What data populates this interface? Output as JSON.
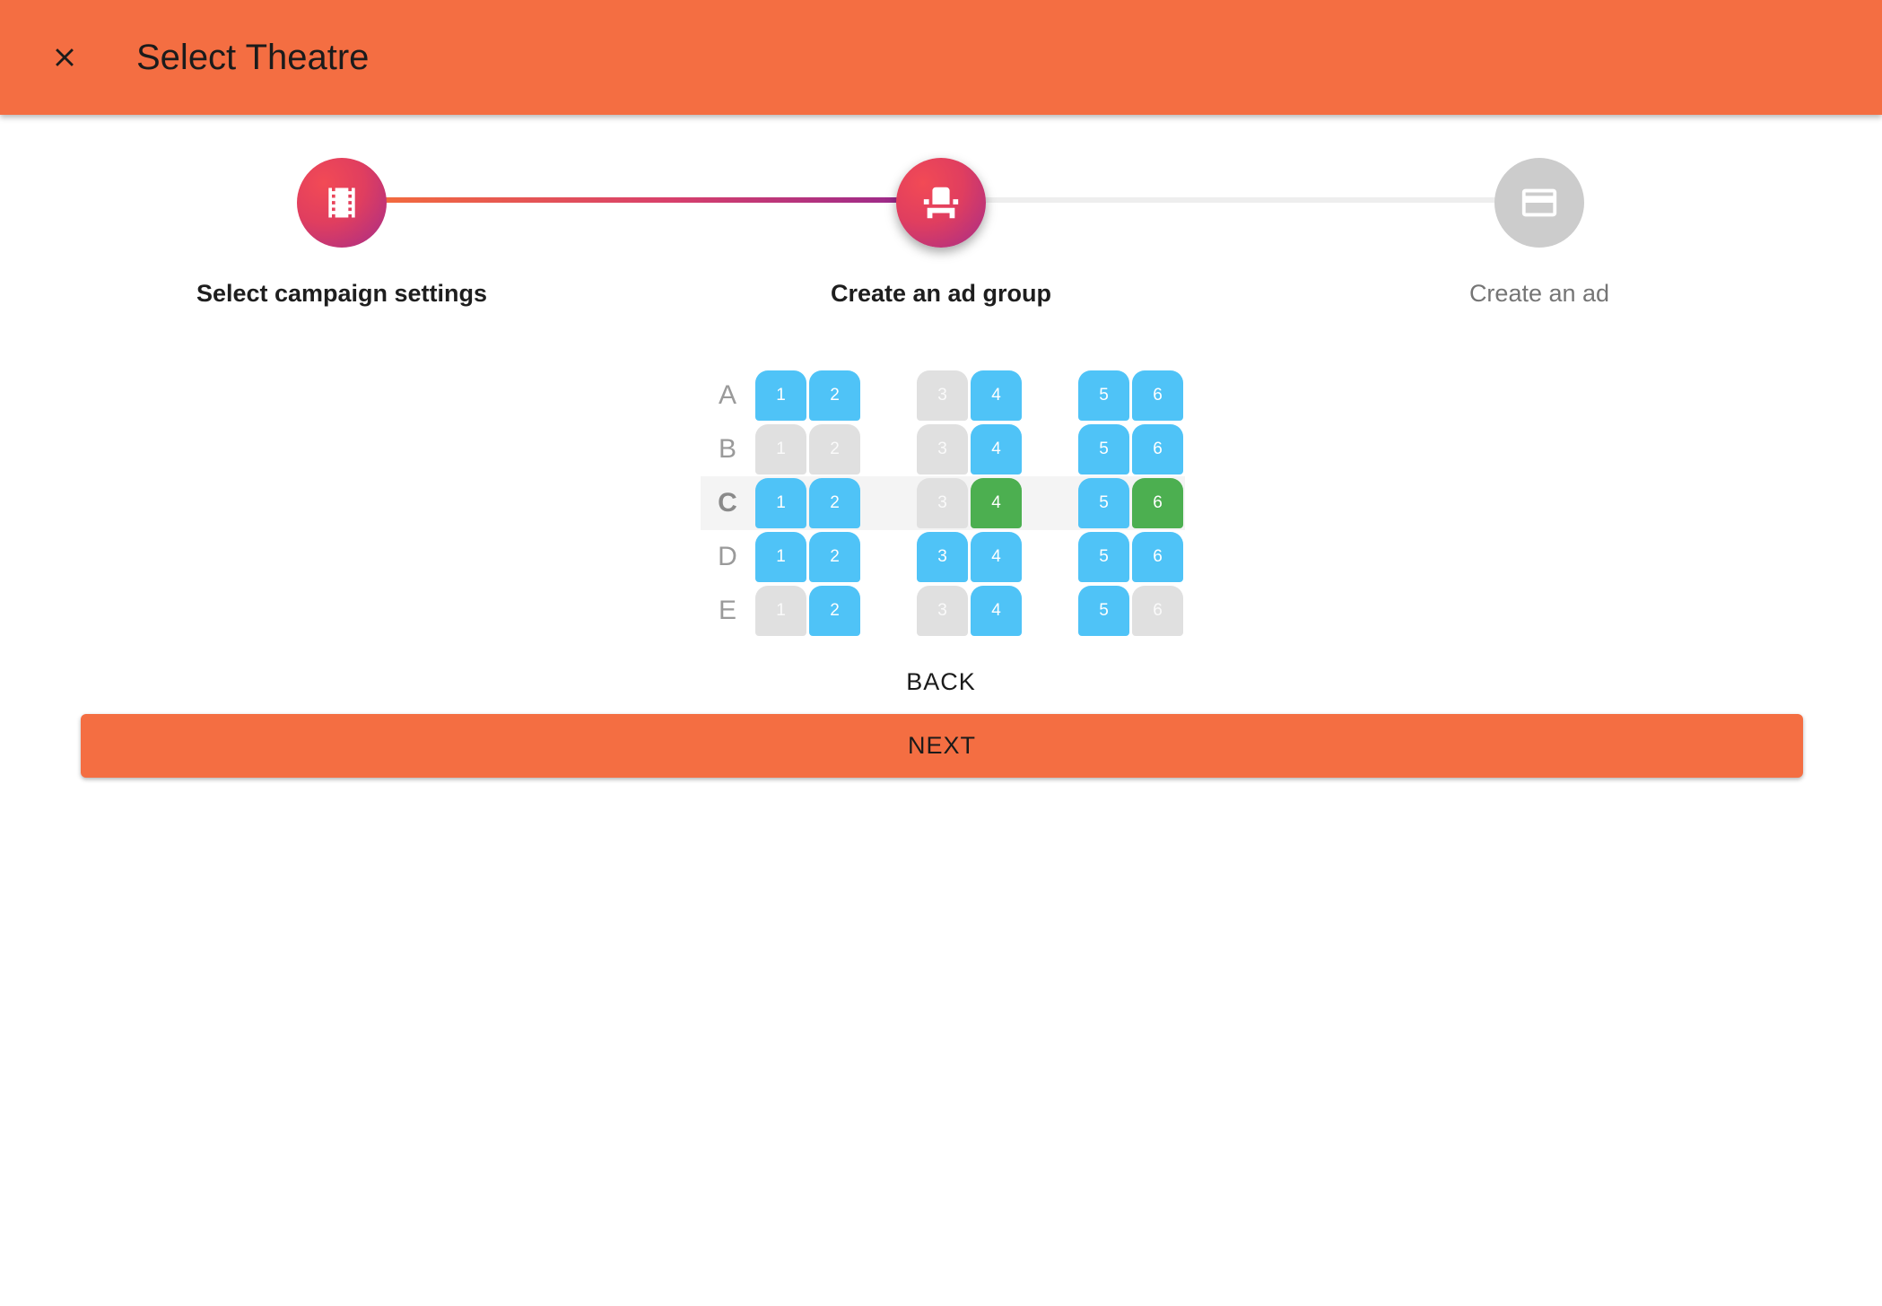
{
  "appbar": {
    "title": "Select Theatre",
    "close_icon": "close-icon",
    "color": "#F46E42"
  },
  "stepper": {
    "steps": [
      {
        "label": "Select campaign settings",
        "icon": "film-icon",
        "state": "completed"
      },
      {
        "label": "Create an ad group",
        "icon": "seat-icon",
        "state": "current"
      },
      {
        "label": "Create an ad",
        "icon": "card-icon",
        "state": "inactive"
      }
    ]
  },
  "seatmap": {
    "legend_colors": {
      "available": "#4FC3F7",
      "taken": "#E0E0E0",
      "selected": "#4CAF50"
    },
    "rows": [
      {
        "label": "A",
        "seats": [
          {
            "n": "1",
            "s": "available"
          },
          {
            "n": "2",
            "s": "available"
          },
          {
            "n": "3",
            "s": "taken"
          },
          {
            "n": "4",
            "s": "available"
          },
          {
            "n": "5",
            "s": "available"
          },
          {
            "n": "6",
            "s": "available"
          }
        ]
      },
      {
        "label": "B",
        "seats": [
          {
            "n": "1",
            "s": "taken"
          },
          {
            "n": "2",
            "s": "taken"
          },
          {
            "n": "3",
            "s": "taken"
          },
          {
            "n": "4",
            "s": "available"
          },
          {
            "n": "5",
            "s": "available"
          },
          {
            "n": "6",
            "s": "available"
          }
        ]
      },
      {
        "label": "C",
        "highlighted": true,
        "seats": [
          {
            "n": "1",
            "s": "available"
          },
          {
            "n": "2",
            "s": "available"
          },
          {
            "n": "3",
            "s": "taken"
          },
          {
            "n": "4",
            "s": "selected"
          },
          {
            "n": "5",
            "s": "available"
          },
          {
            "n": "6",
            "s": "selected"
          }
        ]
      },
      {
        "label": "D",
        "seats": [
          {
            "n": "1",
            "s": "available"
          },
          {
            "n": "2",
            "s": "available"
          },
          {
            "n": "3",
            "s": "available"
          },
          {
            "n": "4",
            "s": "available"
          },
          {
            "n": "5",
            "s": "available"
          },
          {
            "n": "6",
            "s": "available"
          }
        ]
      },
      {
        "label": "E",
        "seats": [
          {
            "n": "1",
            "s": "taken"
          },
          {
            "n": "2",
            "s": "available"
          },
          {
            "n": "3",
            "s": "taken"
          },
          {
            "n": "4",
            "s": "available"
          },
          {
            "n": "5",
            "s": "available"
          },
          {
            "n": "6",
            "s": "taken"
          }
        ]
      }
    ]
  },
  "actions": {
    "back_label": "BACK",
    "next_label": "NEXT"
  }
}
